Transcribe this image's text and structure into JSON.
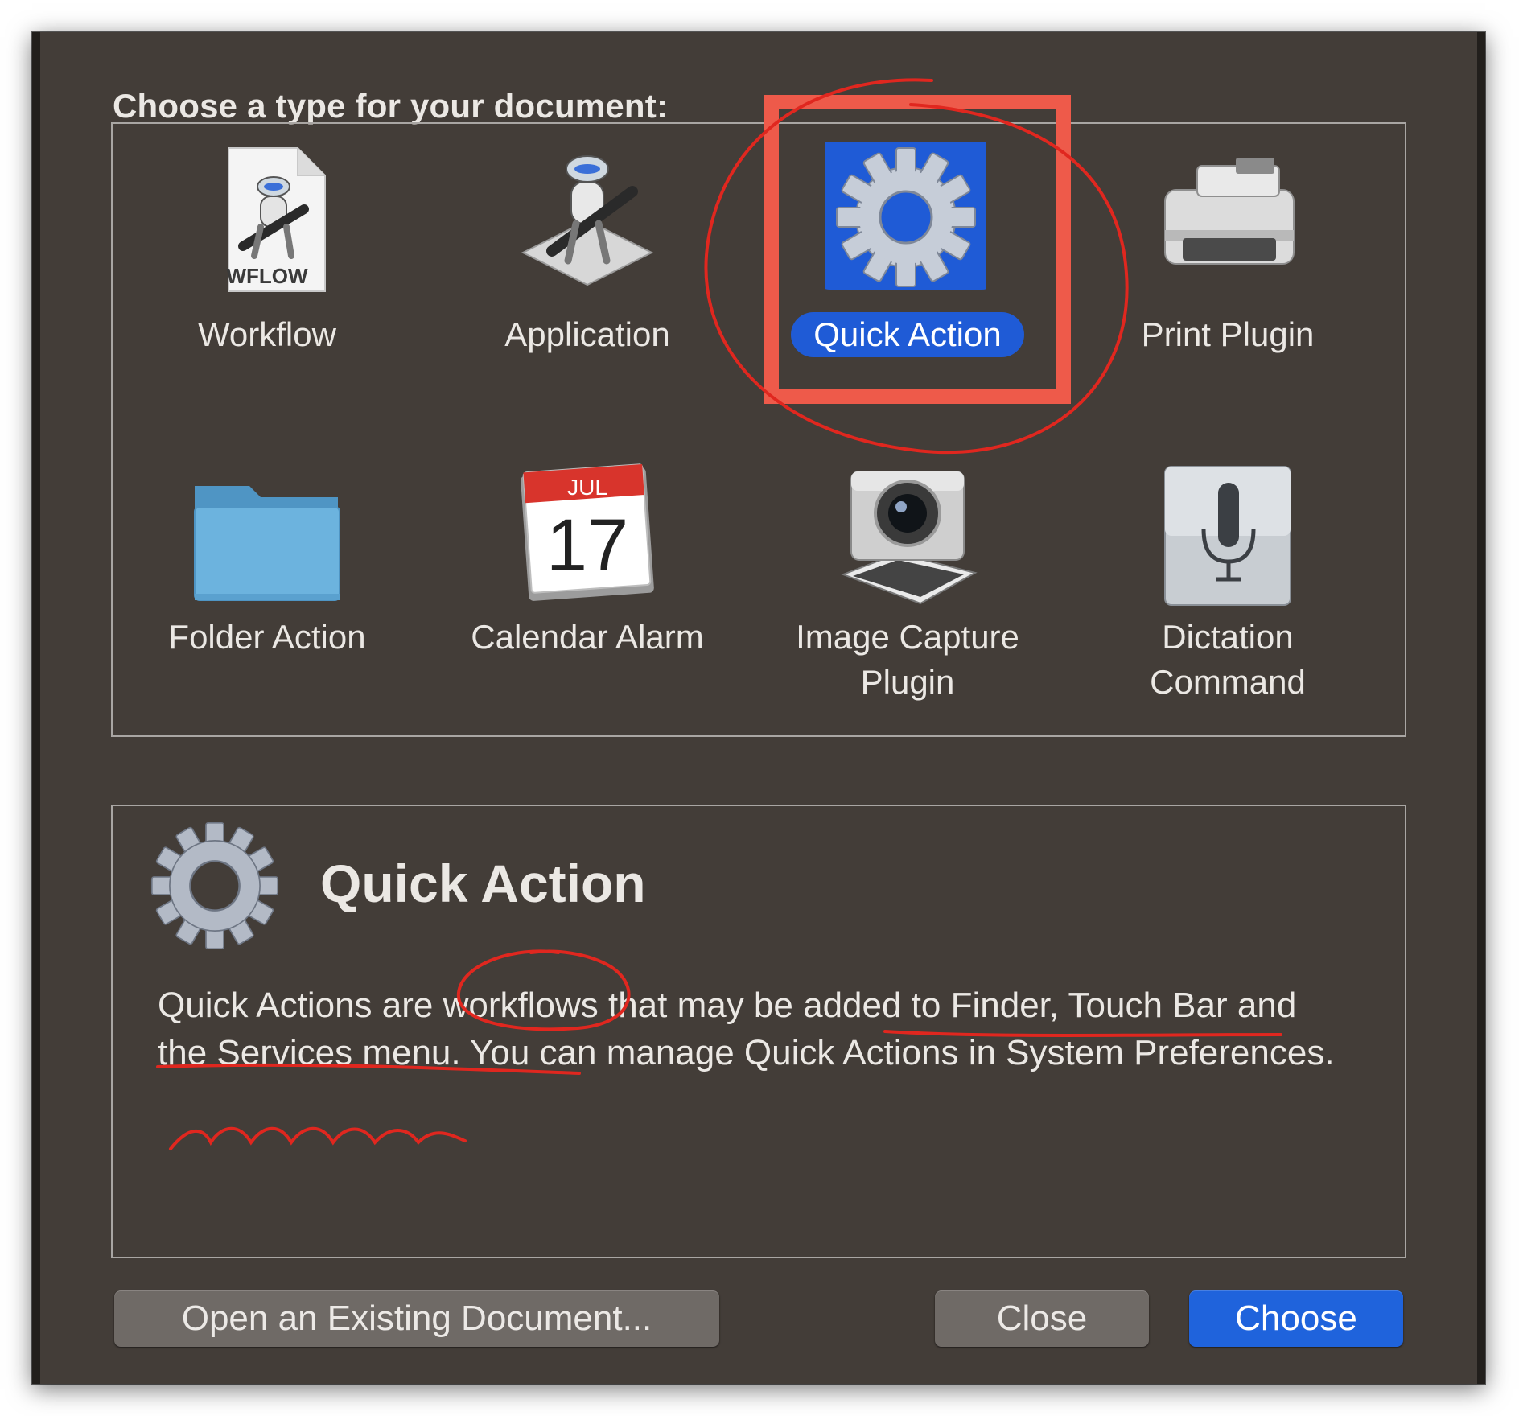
{
  "dialog": {
    "heading": "Choose a type for your document:"
  },
  "types": [
    {
      "label": "Workflow",
      "icon": "workflow-document-icon",
      "file_badge": "WFLOW"
    },
    {
      "label": "Application",
      "icon": "automator-robot-icon"
    },
    {
      "label": "Quick Action",
      "icon": "gear-icon",
      "selected": true
    },
    {
      "label": "Print Plugin",
      "icon": "printer-icon"
    },
    {
      "label": "Folder Action",
      "icon": "folder-icon"
    },
    {
      "label": "Calendar Alarm",
      "icon": "calendar-icon",
      "calendar_month": "JUL",
      "calendar_day": "17"
    },
    {
      "label": "Image Capture Plugin",
      "icon": "image-capture-camera-icon"
    },
    {
      "label": "Dictation Command",
      "icon": "microphone-icon"
    }
  ],
  "info": {
    "title": "Quick Action",
    "description": "Quick Actions are workflows that may be added to Finder, Touch Bar and the Services menu. You can manage Quick Actions in System Preferences.",
    "icon": "gear-icon"
  },
  "buttons": {
    "open_existing": "Open an Existing Document...",
    "close": "Close",
    "choose": "Choose"
  },
  "colors": {
    "dialog_bg": "#433d38",
    "selection": "#1f5bd6",
    "default_button": "#1f63dc",
    "annotation": "#e0271f",
    "annotation_box": "#ee5a4a"
  }
}
